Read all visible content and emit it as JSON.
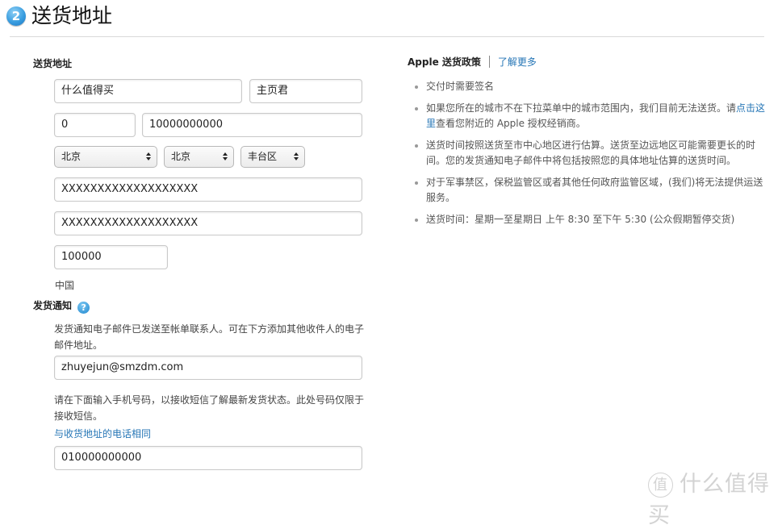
{
  "header": {
    "step_number": "2",
    "title": "送货地址"
  },
  "shipping": {
    "section_label": "送货地址",
    "company": "什么值得买",
    "name": "主页君",
    "area_code": "0",
    "phone": "10000000000",
    "province": "北京",
    "city": "北京",
    "district": "丰台区",
    "address_line1": "XXXXXXXXXXXXXXXXXXX",
    "address_line2": "XXXXXXXXXXXXXXXXXXX",
    "postal_code": "100000",
    "country": "中国"
  },
  "notification": {
    "section_label": "发货通知",
    "help_icon": "?",
    "email_description": "发货通知电子邮件已发送至帐单联系人。可在下方添加其他收件人的电子邮件地址。",
    "email": "zhuyejun@smzdm.com",
    "sms_description": "请在下面输入手机号码，以接收短信了解最新发货状态。此处号码仅限于接收短信。",
    "same_phone_link": "与收货地址的电话相同",
    "mobile": "010000000000"
  },
  "policy": {
    "title": "Apple 送货政策",
    "learn_more": "了解更多",
    "items": [
      {
        "text": "交付时需要签名"
      },
      {
        "text_before": "如果您所在的城市不在下拉菜单中的城市范围内，我们目前无法送货。请",
        "link": "点击这里",
        "text_after": "查看您附近的 Apple 授权经销商。"
      },
      {
        "text": "送货时间按照送货至市中心地区进行估算。送货至边远地区可能需要更长的时间。您的发货通知电子邮件中将包括按照您的具体地址估算的送货时间。"
      },
      {
        "text": "对于军事禁区，保税监管区或者其他任何政府监管区域，(我们)将无法提供运送服务。"
      },
      {
        "text": "送货时间：星期一至星期日 上午 8:30 至下午 5:30 (公众假期暂停交货)"
      }
    ]
  },
  "watermark": {
    "logo_char": "值",
    "text": "什么值得买"
  }
}
